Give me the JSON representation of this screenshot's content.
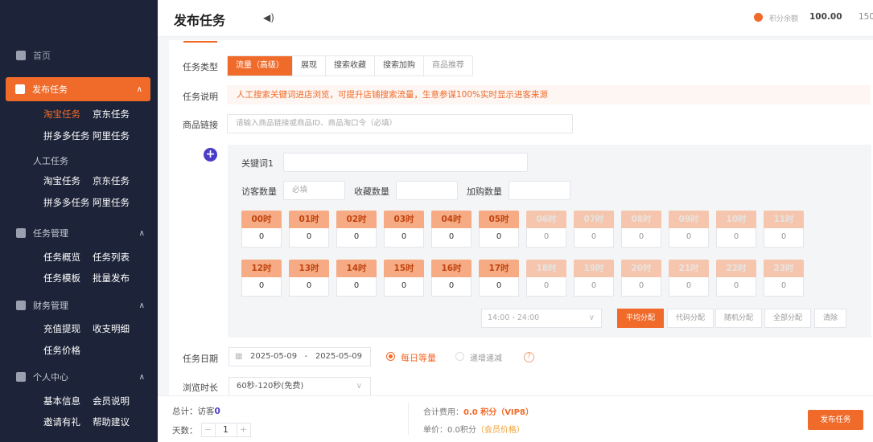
{
  "sidebar": {
    "home": "首页",
    "active_group": "发布任务",
    "publish_sub_row1": [
      "淘宝任务",
      "京东任务"
    ],
    "publish_sub_row2": [
      "拼多多任务",
      "阿里任务"
    ],
    "manual_title": "人工任务",
    "manual_row1": [
      "淘宝任务",
      "京东任务"
    ],
    "manual_row2": [
      "拼多多任务",
      "阿里任务"
    ],
    "task_mgmt": "任务管理",
    "task_mgmt_row1": [
      "任务概览",
      "任务列表"
    ],
    "task_mgmt_row2": [
      "任务模板",
      "批量发布"
    ],
    "finance": "财务管理",
    "finance_row1": [
      "充值提现",
      "收支明细"
    ],
    "finance_row2": [
      "任务价格"
    ],
    "personal": "个人中心",
    "personal_row1": [
      "基本信息",
      "会员说明"
    ],
    "personal_row2": [
      "邀请有礼",
      "帮助建议"
    ]
  },
  "header": {
    "title": "发布任务",
    "balance_label": "积分余额",
    "balance_value": "100.00",
    "extra": "150"
  },
  "form": {
    "type_label": "任务类型",
    "type_tabs": [
      "流量（高级）",
      "展现",
      "搜索收藏",
      "搜索加购",
      "商品推荐"
    ],
    "desc_label": "任务说明",
    "desc_text": "人工搜索关键词进店浏览，可提升店铺搜索流量，生意参谋100%实时显示进客来源",
    "link_label": "商品链接",
    "link_placeholder": "请输入商品链接或商品ID、商品淘口令（必填）",
    "keyword_label": "关键词1",
    "visitors_label": "访客数量",
    "visitors_placeholder": "必填",
    "favorites_label": "收藏数量",
    "cart_label": "加购数量",
    "hours_row1": [
      {
        "h": "00时",
        "v": "0"
      },
      {
        "h": "01时",
        "v": "0"
      },
      {
        "h": "02时",
        "v": "0"
      },
      {
        "h": "03时",
        "v": "0"
      },
      {
        "h": "04时",
        "v": "0"
      },
      {
        "h": "05时",
        "v": "0"
      },
      {
        "h": "06时",
        "v": "0"
      },
      {
        "h": "07时",
        "v": "0"
      },
      {
        "h": "08时",
        "v": "0"
      },
      {
        "h": "09时",
        "v": "0"
      },
      {
        "h": "10时",
        "v": "0"
      },
      {
        "h": "11时",
        "v": "0"
      }
    ],
    "hours_row2": [
      {
        "h": "12时",
        "v": "0"
      },
      {
        "h": "13时",
        "v": "0"
      },
      {
        "h": "14时",
        "v": "0"
      },
      {
        "h": "15时",
        "v": "0"
      },
      {
        "h": "16时",
        "v": "0"
      },
      {
        "h": "17时",
        "v": "0"
      },
      {
        "h": "18时",
        "v": "0"
      },
      {
        "h": "19时",
        "v": "0"
      },
      {
        "h": "20时",
        "v": "0"
      },
      {
        "h": "21时",
        "v": "0"
      },
      {
        "h": "22时",
        "v": "0"
      },
      {
        "h": "23时",
        "v": "0"
      }
    ],
    "time_range": "14:00 - 24:00",
    "presets": [
      "平均分配",
      "代码分配",
      "随机分配",
      "全部分配",
      "清除"
    ],
    "date_label": "任务日期",
    "date_start": "2025-05-09",
    "date_sep": "-",
    "date_end": "2025-05-09",
    "daily_equal": "每日等量",
    "daily_increment": "递增递减",
    "duration_label": "浏览时长",
    "duration_value": "60秒-120秒(免费)"
  },
  "footer": {
    "total_label": "总计：访客",
    "total_value": "0",
    "days_label": "天数：",
    "days_value": "1",
    "cost_label": "合计费用：",
    "cost_value": "0.0 积分（VIP8）",
    "price_label": "单价：0.0积分",
    "price_note": "（会员价格）",
    "submit": "发布任务"
  },
  "colors": {
    "accent": "#f06a2a",
    "sidebar": "#1d2439",
    "plus": "#4a3ec9"
  }
}
